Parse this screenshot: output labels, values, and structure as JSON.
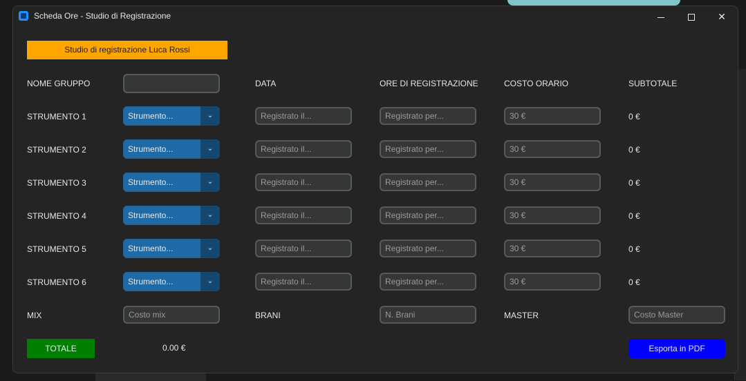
{
  "window": {
    "title": "Scheda Ore - Studio di Registrazione"
  },
  "studio_label": "Studio di registrazione Luca Rossi",
  "colors": {
    "banner": "#ffa500",
    "totale": "#008000",
    "export": "#0000ff",
    "combo": "#1f6aa5"
  },
  "headers": {
    "nome_gruppo": "NOME GRUPPO",
    "data": "DATA",
    "ore": "ORE DI REGISTRAZIONE",
    "costo_orario": "COSTO ORARIO",
    "subtotale": "SUBTOTALE"
  },
  "nome_gruppo_value": "",
  "instruments": [
    {
      "label": "STRUMENTO 1",
      "select": "Strumento...",
      "date_placeholder": "Registrato il...",
      "hours_placeholder": "Registrato per...",
      "rate_placeholder": "30 €",
      "subtotal": "0 €"
    },
    {
      "label": "STRUMENTO 2",
      "select": "Strumento...",
      "date_placeholder": "Registrato il...",
      "hours_placeholder": "Registrato per...",
      "rate_placeholder": "30 €",
      "subtotal": "0 €"
    },
    {
      "label": "STRUMENTO 3",
      "select": "Strumento...",
      "date_placeholder": "Registrato il...",
      "hours_placeholder": "Registrato per...",
      "rate_placeholder": "30 €",
      "subtotal": "0 €"
    },
    {
      "label": "STRUMENTO 4",
      "select": "Strumento...",
      "date_placeholder": "Registrato il...",
      "hours_placeholder": "Registrato per...",
      "rate_placeholder": "30 €",
      "subtotal": "0 €"
    },
    {
      "label": "STRUMENTO 5",
      "select": "Strumento...",
      "date_placeholder": "Registrato il...",
      "hours_placeholder": "Registrato per...",
      "rate_placeholder": "30 €",
      "subtotal": "0 €"
    },
    {
      "label": "STRUMENTO 6",
      "select": "Strumento...",
      "date_placeholder": "Registrato il...",
      "hours_placeholder": "Registrato per...",
      "rate_placeholder": "30 €",
      "subtotal": "0 €"
    }
  ],
  "mix": {
    "label": "MIX",
    "placeholder": "Costo mix"
  },
  "brani": {
    "label": "BRANI",
    "placeholder": "N. Brani"
  },
  "master": {
    "label": "MASTER",
    "placeholder": "Costo Master"
  },
  "totale": {
    "label": "TOTALE",
    "value": "0.00 €"
  },
  "export_label": "Esporta in PDF"
}
